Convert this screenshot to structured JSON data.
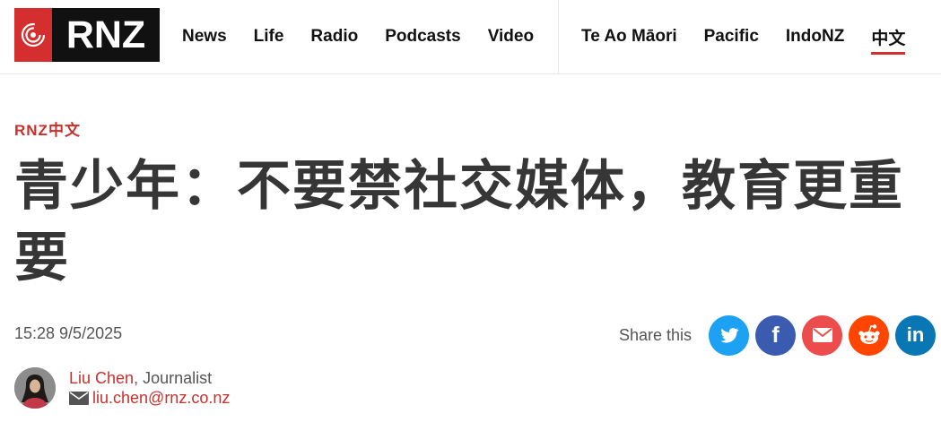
{
  "logo": {
    "text": "RNZ"
  },
  "nav": {
    "main": [
      "News",
      "Life",
      "Radio",
      "Podcasts",
      "Video"
    ],
    "lang": [
      "Te Ao Māori",
      "Pacific",
      "IndoNZ",
      "中文"
    ]
  },
  "article": {
    "section": "RNZ中文",
    "title": "青少年：不要禁社交媒体，教育更重要",
    "timestamp": "15:28 9/5/2025"
  },
  "share": {
    "label": "Share this",
    "buttons": [
      "twitter-icon",
      "facebook-icon",
      "email-icon",
      "reddit-icon",
      "linkedin-icon"
    ]
  },
  "author": {
    "name": "Liu Chen",
    "role": ", Journalist",
    "email": "liu.chen@rnz.co.nz"
  },
  "colors": {
    "brand_red": "#d42e2e",
    "text_dark": "#363636"
  }
}
